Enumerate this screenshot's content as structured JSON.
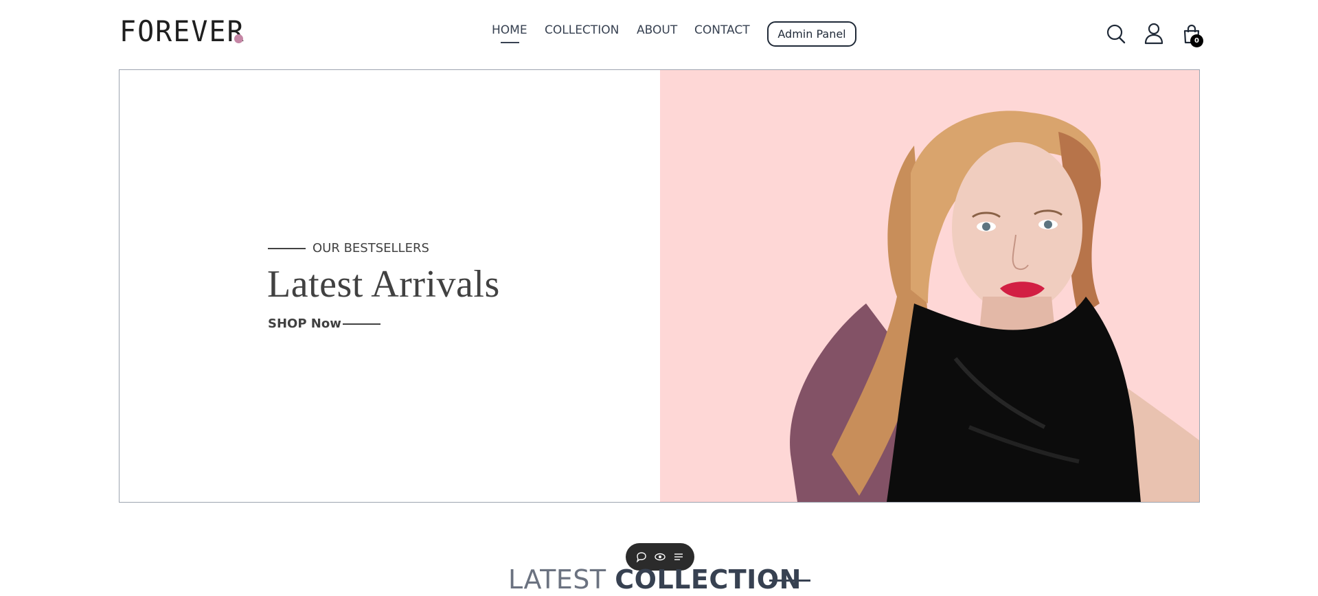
{
  "header": {
    "logo_text": "FOREVER",
    "nav": [
      {
        "label": "HOME",
        "active": true
      },
      {
        "label": "COLLECTION",
        "active": false
      },
      {
        "label": "ABOUT",
        "active": false
      },
      {
        "label": "CONTACT",
        "active": false
      }
    ],
    "admin_button_label": "Admin Panel",
    "cart_count": "0",
    "icons": [
      "search-icon",
      "profile-icon",
      "cart-icon"
    ]
  },
  "hero": {
    "eyebrow": "OUR BESTSELLERS",
    "title": "Latest Arrivals",
    "cta": "SHOP Now",
    "image_background": "#fed7d6"
  },
  "floating_toolbar": {
    "icons": [
      "comment-icon",
      "eye-icon",
      "list-icon"
    ]
  },
  "section": {
    "title_light": "LATEST",
    "title_bold": "COLLECTION"
  },
  "colors": {
    "text": "#374151",
    "accent_dot": "#c586a5",
    "hero_pink": "#fed7d6"
  }
}
